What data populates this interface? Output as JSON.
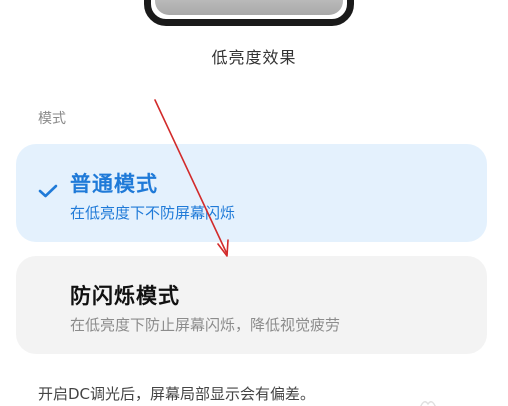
{
  "preview": {
    "caption": "低亮度效果"
  },
  "section": {
    "label": "模式"
  },
  "modes": [
    {
      "title": "普通模式",
      "description": "在低亮度下不防屏幕闪烁",
      "selected": true
    },
    {
      "title": "防闪烁模式",
      "description": "在低亮度下防止屏幕闪烁，降低视觉疲劳",
      "selected": false
    }
  ],
  "footnote": "开启DC调光后，屏幕局部显示会有偏差。",
  "colors": {
    "accent": "#1f7ad8",
    "selected_card_bg": "#e4f1fd",
    "card_bg": "#f3f3f3",
    "annotation_arrow": "#d22b2b"
  },
  "icons": {
    "selected_marker": "checkmark-icon"
  }
}
